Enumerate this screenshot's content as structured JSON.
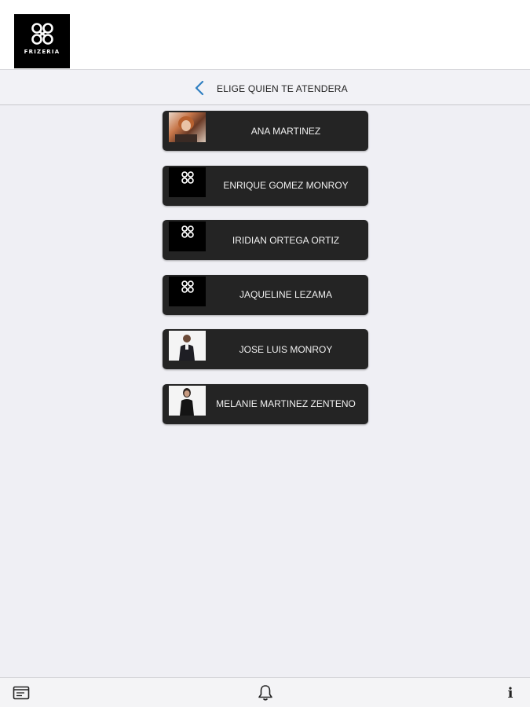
{
  "brand": {
    "logo_text": "FRIZERIA"
  },
  "header": {
    "back_icon": "chevron-left-icon",
    "title": "ELIGE QUIEN TE ATENDERA",
    "accent_color": "#2f7fc1"
  },
  "staff": [
    {
      "name": "ANA MARTINEZ",
      "photo": "portrait-photo"
    },
    {
      "name": "ENRIQUE GOMEZ MONROY",
      "photo": "frizeria-logo"
    },
    {
      "name": "IRIDIAN ORTEGA ORTIZ",
      "photo": "frizeria-logo"
    },
    {
      "name": "JAQUELINE LEZAMA",
      "photo": "frizeria-logo"
    },
    {
      "name": "JOSE LUIS MONROY",
      "photo": "portrait-photo"
    },
    {
      "name": "MELANIE MARTINEZ ZENTENO",
      "photo": "portrait-photo"
    }
  ],
  "bottom_nav": {
    "calendar_icon": "calendar-icon",
    "bell_icon": "bell-icon",
    "info_label": "i"
  }
}
